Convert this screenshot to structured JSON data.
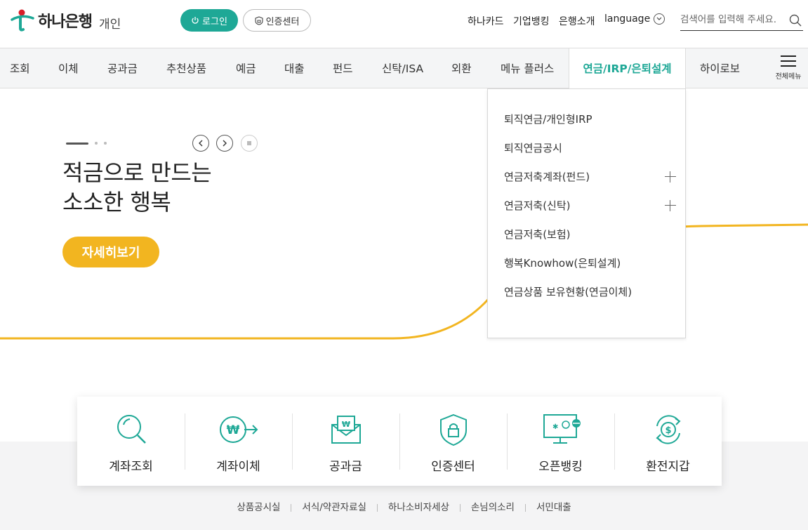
{
  "header": {
    "logo_text": "하나은행",
    "logo_sub": "개인",
    "login_label": "로그인",
    "cert_label": "인증센터",
    "top_links": [
      "하나카드",
      "기업뱅킹",
      "은행소개"
    ],
    "language_label": "language",
    "search_placeholder": "검색어를 입력해 주세요."
  },
  "nav": {
    "items": [
      "조회",
      "이체",
      "공과금",
      "추천상품",
      "예금",
      "대출",
      "펀드",
      "신탁/ISA",
      "외환",
      "메뉴 플러스",
      "연금/IRP/은퇴설계",
      "하이로보"
    ],
    "active": "연금/IRP/은퇴설계",
    "all_menu_label": "전체메뉴"
  },
  "hero": {
    "title_line1": "적금으로 만드는",
    "title_line2": "소소한 행복",
    "button_label": "자세히보기"
  },
  "dropdown": {
    "items": [
      {
        "label": "퇴직연금/개인형IRP",
        "expandable": false
      },
      {
        "label": "퇴직연금공시",
        "expandable": false
      },
      {
        "label": "연금저축계좌(펀드)",
        "expandable": true
      },
      {
        "label": "연금저축(신탁)",
        "expandable": true
      },
      {
        "label": "연금저축(보험)",
        "expandable": false
      },
      {
        "label": "행복Knowhow(은퇴설계)",
        "expandable": false
      },
      {
        "label": "연금상품 보유현황(연금이체)",
        "expandable": false
      }
    ]
  },
  "quick_menu": {
    "items": [
      "계좌조회",
      "계좌이체",
      "공과금",
      "인증센터",
      "오픈뱅킹",
      "환전지갑"
    ]
  },
  "footer": {
    "links": [
      "상품공시실",
      "서식/약관자료실",
      "하나소비자세상",
      "손님의소리",
      "서민대출"
    ]
  },
  "colors": {
    "brand_teal": "#1ea896",
    "accent_yellow": "#f2b520",
    "nav_bg": "#f4f5f6"
  }
}
